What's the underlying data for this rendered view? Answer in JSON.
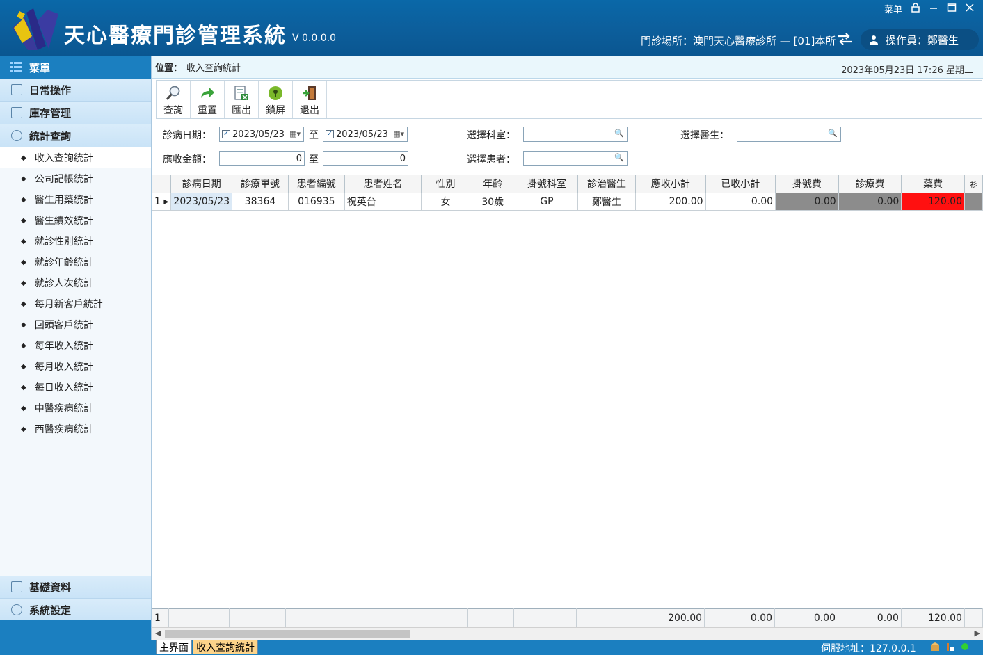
{
  "header": {
    "title": "天心醫療門診管理系統",
    "version": "V 0.0.0.0",
    "menu_label": "菜单",
    "clinic": "門診場所：澳門天心醫療診所 — [01]本所",
    "operator": "操作員：鄭醫生"
  },
  "sidebar": {
    "menu_title": "菜單",
    "groups": [
      {
        "label": "日常操作"
      },
      {
        "label": "庫存管理"
      },
      {
        "label": "統計查詢"
      }
    ],
    "items": [
      "收入查詢統計",
      "公司記帳統計",
      "醫生用藥統計",
      "醫生績效統計",
      "就診性別統計",
      "就診年齡統計",
      "就診人次統計",
      "每月新客戶統計",
      "回頭客戶統計",
      "每年收入統計",
      "每月收入統計",
      "每日收入統計",
      "中醫疾病統計",
      "西醫疾病統計"
    ],
    "bottom_groups": [
      {
        "label": "基礎資料"
      },
      {
        "label": "系統設定"
      }
    ]
  },
  "breadcrumb": {
    "label": "位置：",
    "path": "收入查詢統計",
    "datetime": "2023年05月23日 17:26  星期二"
  },
  "toolbar": {
    "query": "查詢",
    "reset": "重置",
    "export": "匯出",
    "lock": "鎖屏",
    "exit": "退出"
  },
  "filters": {
    "date_label": "診病日期：",
    "date_from": "2023/05/23",
    "to1": "至",
    "date_to": "2023/05/23",
    "amount_label": "應收金額：",
    "amount_from": "0",
    "to2": "至",
    "amount_to": "0",
    "dept_label": "選擇科室：",
    "dept_value": "",
    "patient_label": "選擇患者：",
    "patient_value": "",
    "doctor_label": "選擇醫生：",
    "doctor_value": ""
  },
  "grid": {
    "columns": [
      "診病日期",
      "診療單號",
      "患者編號",
      "患者姓名",
      "性別",
      "年齡",
      "掛號科室",
      "診治醫生",
      "應收小計",
      "已收小計",
      "掛號費",
      "診療費",
      "藥費",
      "衫"
    ],
    "rows": [
      {
        "index": "1",
        "cells": [
          "2023/05/23",
          "38364",
          "016935",
          "祝英台",
          "女",
          "30歲",
          "GP",
          "鄭醫生",
          "200.00",
          "0.00",
          "0.00",
          "0.00",
          "120.00",
          ""
        ]
      }
    ],
    "totals": {
      "index": "1",
      "receivable": "200.00",
      "received": "0.00",
      "registration": "0.00",
      "consultation": "0.00",
      "medicine": "120.00"
    }
  },
  "statusbar": {
    "tab_main": "主界面",
    "tab_income": "收入查詢統計",
    "server": "伺服地址：127.0.0.1"
  },
  "colors": {
    "header_blue": "#0c5d9a",
    "menu_blue": "#1b7fc0",
    "red_cell": "#ff1010",
    "gray_cell": "#8c8c8c"
  }
}
